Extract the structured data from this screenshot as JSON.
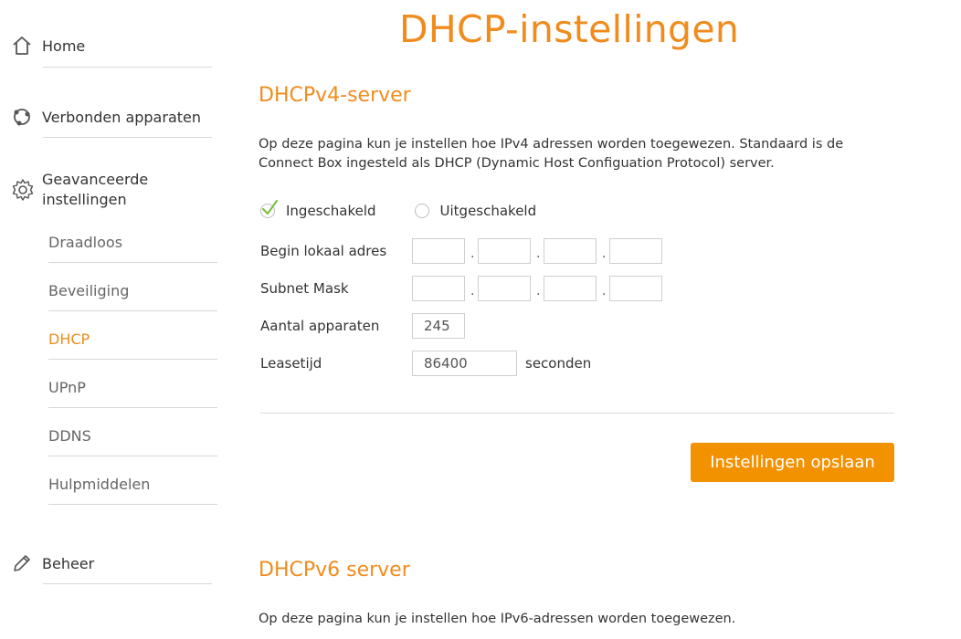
{
  "sidebar": {
    "home": "Home",
    "connected": "Verbonden apparaten",
    "advanced_line1": "Geavanceerde",
    "advanced_line2": "instellingen",
    "sub": [
      "Draadloos",
      "Beveiliging",
      "DHCP",
      "UPnP",
      "DDNS",
      "Hulpmiddelen"
    ],
    "active": "DHCP",
    "admin": "Beheer"
  },
  "page_title": "DHCP-instellingen",
  "v4": {
    "title": "DHCPv4-server",
    "desc_line1": "Op deze pagina kun je instellen hoe IPv4 adressen worden toegewezen. Standaard is de",
    "desc_line2": "Connect Box ingesteld als DHCP (Dynamic Host Configuation Protocol) server.",
    "enabled_label": "Ingeschakeld",
    "disabled_label": "Uitgeschakeld",
    "selected": "Ingeschakeld",
    "start_label": "Begin lokaal adres",
    "subnet_label": "Subnet Mask",
    "count_label": "Aantal apparaten",
    "count_value": "245",
    "lease_label": "Leasetijd",
    "lease_value": "86400",
    "lease_unit": "seconden",
    "save_label": "Instellingen opslaan"
  },
  "v6": {
    "title": "DHCPv6 server",
    "desc": "Op deze pagina kun je instellen hoe IPv6-adressen worden toegewezen."
  },
  "colors": {
    "accent": "#f08c1e",
    "button": "#f39200",
    "check": "#7ac143"
  },
  "icons": [
    "home-icon",
    "devices-icon",
    "gear-icon",
    "pencil-icon",
    "checkmark-icon"
  ]
}
